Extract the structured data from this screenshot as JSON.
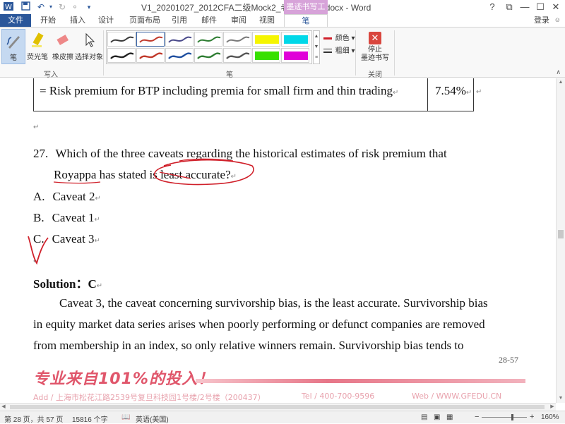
{
  "titlebar": {
    "title": "V1_20201027_2012CFA二级Mock2_老师授课版.docx - Word",
    "tool_tab": "墨迹书写工具",
    "help": "?",
    "restore": "⧉",
    "minimize": "—",
    "maximize": "☐",
    "close": "✕"
  },
  "tabs": [
    "文件",
    "开始",
    "插入",
    "设计",
    "页面布局",
    "引用",
    "邮件",
    "审阅",
    "视图",
    "笔"
  ],
  "login_label": "登录",
  "ribbon": {
    "write_group": {
      "label": "写入",
      "tools": [
        "笔",
        "荧光笔",
        "橡皮擦",
        "选择对象"
      ]
    },
    "pens_group": {
      "label": "笔",
      "color_label": "颜色",
      "thickness_label": "粗细",
      "pens": [
        {
          "color": "#3a3a3a"
        },
        {
          "color": "#c0392b"
        },
        {
          "color": "#4a4a8a"
        },
        {
          "color": "#2e7d32"
        },
        {
          "color": "#7a7a7a"
        },
        {
          "color": "#f5f500"
        },
        {
          "color": "#00d8e8"
        },
        {
          "color": "#222222"
        },
        {
          "color": "#c0392b"
        },
        {
          "color": "#1f4fa0"
        },
        {
          "color": "#2e7d32"
        },
        {
          "color": "#555555"
        },
        {
          "color": "#37e000"
        },
        {
          "color": "#e000d8"
        }
      ]
    },
    "close_group": {
      "label": "关闭",
      "stop_label_1": "停止",
      "stop_label_2": "墨迹书写"
    }
  },
  "document": {
    "table_row": {
      "label": "= Risk premium for BTP including premia for small firm and thin trading",
      "value": "7.54%"
    },
    "question_number": "27.",
    "question_line1": "Which of the three caveats regarding the historical estimates of risk premium that",
    "question_line2": "Royappa has stated is least accurate?",
    "options": [
      {
        "letter": "A.",
        "text": "Caveat 2"
      },
      {
        "letter": "B.",
        "text": "Caveat 1"
      },
      {
        "letter": "C.",
        "text": "Caveat 3"
      }
    ],
    "solution_label": "Solution：",
    "solution_answer": "C",
    "para_line1": "Caveat 3, the caveat concerning survivorship bias, is the least accurate. Survivorship bias",
    "para_line2": "in equity market data series arises when poorly performing or defunct companies are removed",
    "para_line3": "from membership in an index, so only relative winners remain. Survivorship bias tends to",
    "page_number": "28-57",
    "promo_slogan": "专业来自101%的投入！",
    "footer_address": "Add / 上海市松花江路2539号复旦科技园1号楼/2号楼（200437）",
    "footer_tel": "Tel / 400-700-9596",
    "footer_web": "Web / WWW.GFEDU.CN"
  },
  "statusbar": {
    "page_info": "第 28 页，共 57 页",
    "word_count": "15816 个字",
    "language": "英语(美国)",
    "zoom": "160%"
  },
  "colors": {
    "word_blue": "#2b579a",
    "ink_red": "#d0202a",
    "tool_tab": "#d7a3d9",
    "promo_pink": "#e0566b"
  }
}
